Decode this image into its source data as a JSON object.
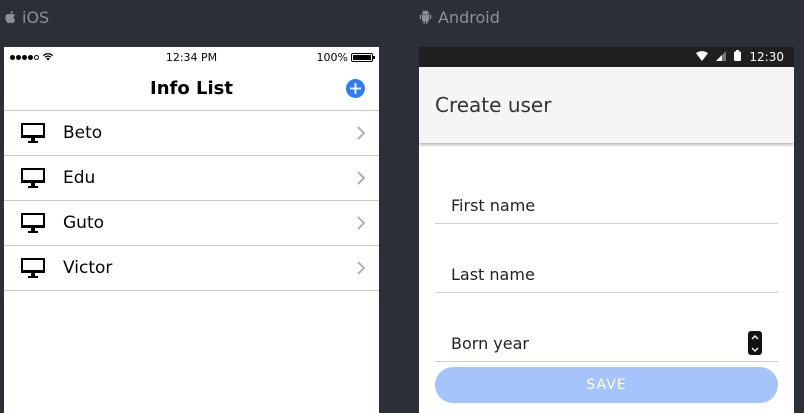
{
  "labels": {
    "ios": "iOS",
    "android": "Android"
  },
  "ios": {
    "status": {
      "time": "12:34 PM",
      "battery": "100%"
    },
    "nav": {
      "title": "Info List"
    },
    "items": [
      {
        "label": "Beto"
      },
      {
        "label": "Edu"
      },
      {
        "label": "Guto"
      },
      {
        "label": "Victor"
      }
    ],
    "icons": {
      "add": "plus-circle-icon",
      "row": "monitor-icon",
      "disclosure": "chevron-right-icon"
    },
    "accent": "#2f7cf6"
  },
  "android": {
    "status": {
      "time": "12:30"
    },
    "toolbar": {
      "title": "Create user"
    },
    "form": {
      "first_name": {
        "placeholder": "First name"
      },
      "last_name": {
        "placeholder": "Last name"
      },
      "born_year": {
        "placeholder": "Born year"
      }
    },
    "save": {
      "label": "SAVE"
    },
    "button_color": "#a4c4fb"
  }
}
